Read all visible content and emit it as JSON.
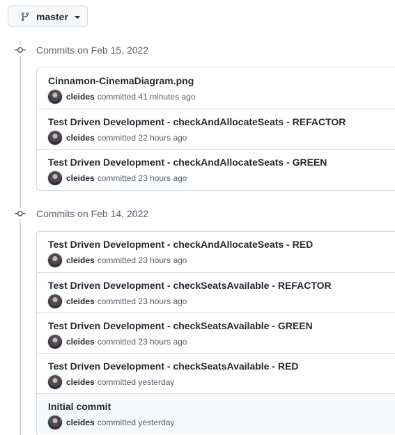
{
  "branch": {
    "label": "master",
    "icon": "git-branch-icon"
  },
  "groups": [
    {
      "title": "Commits on Feb 15, 2022",
      "commits": [
        {
          "message": "Cinnamon-CinemaDiagram.png",
          "author": "cleides",
          "action": "committed",
          "time": "41 minutes ago"
        },
        {
          "message": "Test Driven Development - checkAndAllocateSeats - REFACTOR",
          "author": "cleides",
          "action": "committed",
          "time": "22 hours ago"
        },
        {
          "message": "Test Driven Development - checkAndAllocateSeats - GREEN",
          "author": "cleides",
          "action": "committed",
          "time": "23 hours ago"
        }
      ]
    },
    {
      "title": "Commits on Feb 14, 2022",
      "commits": [
        {
          "message": "Test Driven Development - checkAndAllocateSeats - RED",
          "author": "cleides",
          "action": "committed",
          "time": "23 hours ago"
        },
        {
          "message": "Test Driven Development - checkSeatsAvailable - REFACTOR",
          "author": "cleides",
          "action": "committed",
          "time": "23 hours ago"
        },
        {
          "message": "Test Driven Development - checkSeatsAvailable - GREEN",
          "author": "cleides",
          "action": "committed",
          "time": "23 hours ago"
        },
        {
          "message": "Test Driven Development - checkSeatsAvailable - RED",
          "author": "cleides",
          "action": "committed",
          "time": "yesterday"
        },
        {
          "message": "Initial commit",
          "author": "cleides",
          "action": "committed",
          "time": "yesterday"
        }
      ]
    }
  ]
}
